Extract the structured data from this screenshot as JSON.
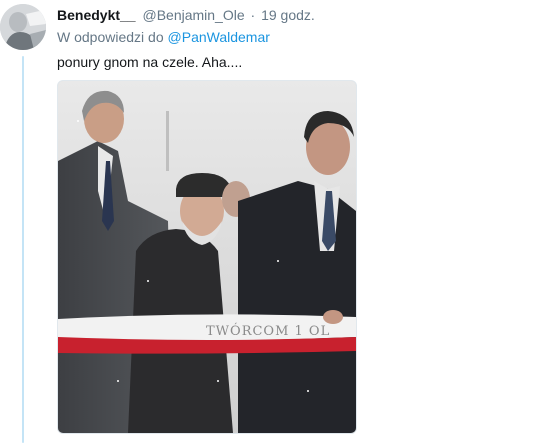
{
  "tweet": {
    "display_name": "Benedykt__",
    "handle": "@Benjamin_Ole",
    "separator": "·",
    "time": "19 godz.",
    "reply_prefix": "W odpowiedzi do",
    "reply_target": "@PanWaldemar",
    "text": "ponury gnom na czele. Aha....",
    "media": {
      "ribbon_text": "TWÓRCOM 1 OL"
    }
  },
  "colors": {
    "name": "#14171a",
    "muted": "#657786",
    "link": "#1b95e0",
    "thread_line": "#c4e4f6"
  },
  "icons": {
    "avatar": "user-avatar-photo"
  }
}
